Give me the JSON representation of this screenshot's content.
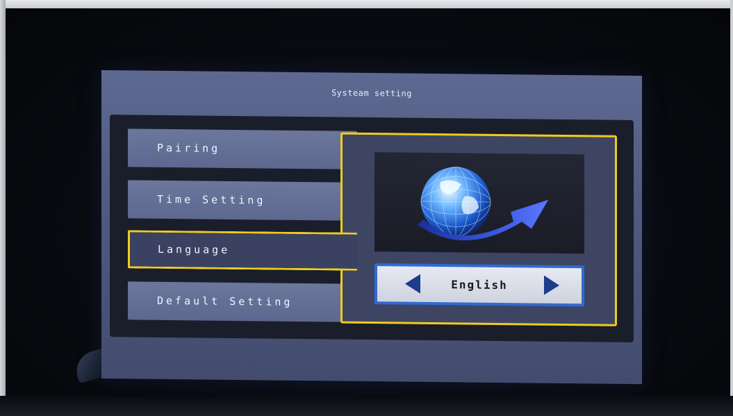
{
  "screen": {
    "title": "Systeam setting"
  },
  "menu": {
    "items": [
      {
        "label": "Pairing",
        "selected": false
      },
      {
        "label": "Time Setting",
        "selected": false
      },
      {
        "label": "Language",
        "selected": true
      },
      {
        "label": "Default Setting",
        "selected": false
      }
    ]
  },
  "detail": {
    "illustration_icon": "globe-arrow-icon",
    "language": {
      "value": "English",
      "prev_icon": "triangle-left-icon",
      "next_icon": "triangle-right-icon"
    }
  },
  "colors": {
    "highlight": "#f1cc1d",
    "menu_bg": "#6c779c",
    "selector_border": "#2f6bd2",
    "arrow": "#1e3c8c"
  }
}
